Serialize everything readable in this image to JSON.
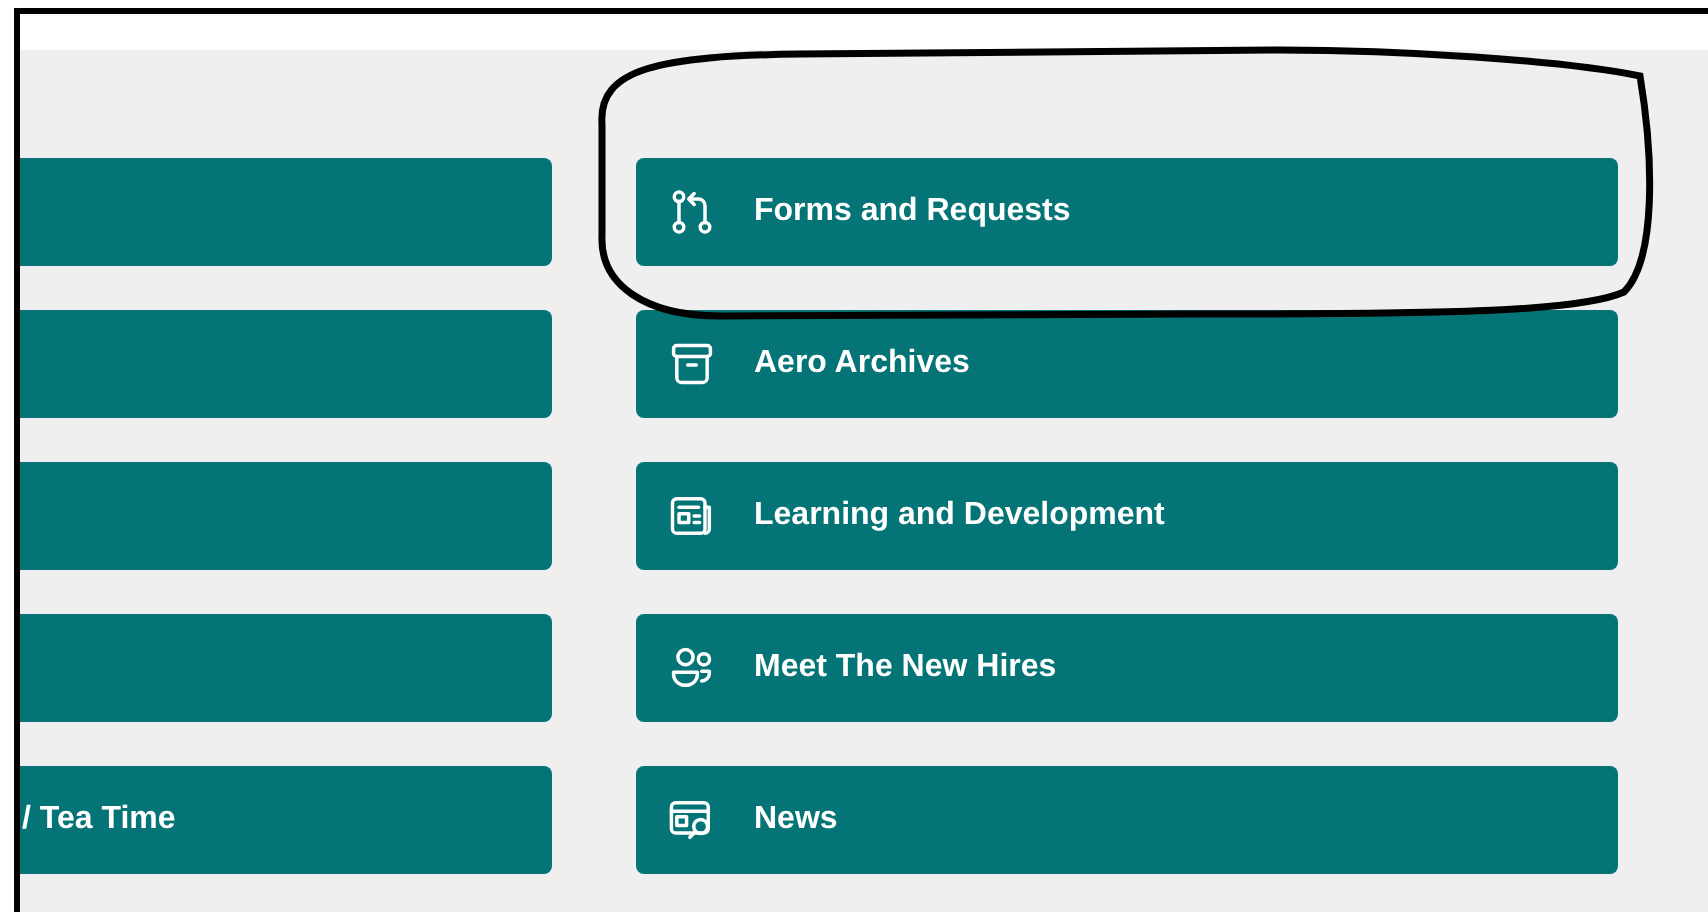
{
  "left_column": [
    {
      "kind": "blank"
    },
    {
      "kind": "blank"
    },
    {
      "kind": "blank"
    },
    {
      "kind": "blank"
    },
    {
      "kind": "text",
      "label": "/ Tea Time"
    }
  ],
  "right_column": [
    {
      "label": "Forms and Requests",
      "kind": "branch",
      "highlighted": true
    },
    {
      "label": "Aero Archives",
      "kind": "archive",
      "highlighted": false
    },
    {
      "label": "Learning and Development",
      "kind": "article",
      "highlighted": false
    },
    {
      "label": "Meet The New Hires",
      "kind": "people",
      "highlighted": false
    },
    {
      "label": "News",
      "kind": "news",
      "highlighted": false
    }
  ]
}
